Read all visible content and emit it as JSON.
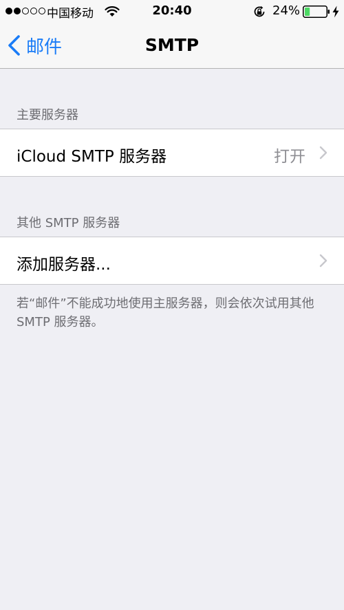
{
  "status_bar": {
    "carrier": "中国移动",
    "time": "20:40",
    "battery_percent": "24%",
    "battery_level": 0.24,
    "signal_filled": 2,
    "signal_total": 5,
    "battery_color": "#4cd964"
  },
  "nav": {
    "back_label": "邮件",
    "title": "SMTP"
  },
  "primary_section": {
    "header": "主要服务器",
    "items": [
      {
        "label": "iCloud SMTP 服务器",
        "value": "打开"
      }
    ]
  },
  "other_section": {
    "header": "其他 SMTP 服务器",
    "items": [
      {
        "label": "添加服务器..."
      }
    ]
  },
  "footer_note": "若“邮件”不能成功地使用主服务器，则会依次试用其他 SMTP 服务器。",
  "colors": {
    "accent": "#1a7cf7",
    "background": "#efeff4",
    "secondary_text": "#8e8e93"
  },
  "icons": {
    "back": "chevron-left-icon",
    "disclosure": "chevron-right-icon",
    "wifi": "wifi-icon",
    "rotation_lock": "rotation-lock-icon",
    "battery": "battery-icon",
    "charging": "bolt-icon"
  }
}
